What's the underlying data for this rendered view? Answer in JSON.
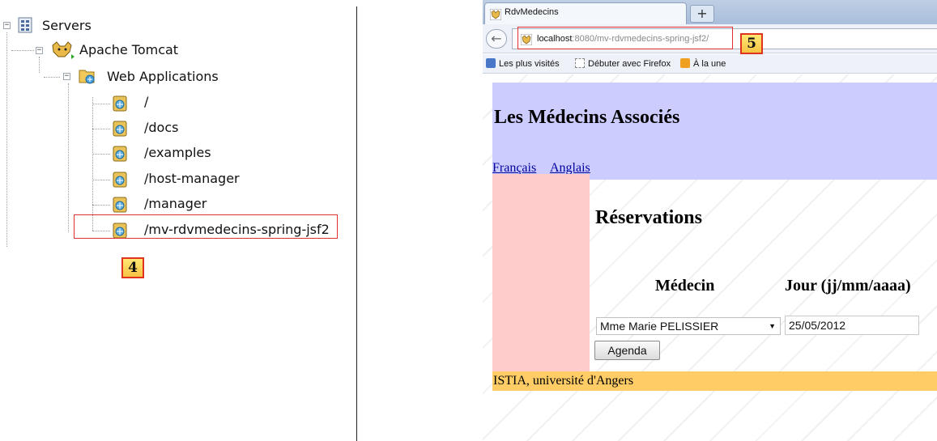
{
  "tree": {
    "servers": "Servers",
    "tomcat": "Apache Tomcat",
    "webapps": "Web Applications",
    "apps": [
      "/",
      "/docs",
      "/examples",
      "/host-manager",
      "/manager",
      "/mv-rdvmedecins-spring-jsf2"
    ],
    "marker": "4",
    "icons": {
      "servers": "servers-icon",
      "tomcat": "tomcat-icon",
      "webapps": "web-applications-icon",
      "app": "web-app-icon"
    }
  },
  "browser": {
    "tab_title": "RdvMedecins",
    "new_tab": "+",
    "url_host": "localhost",
    "url_rest": ":8080/mv-rdvmedecins-spring-jsf2/",
    "marker": "5",
    "bookmarks": [
      "Les plus visités",
      "Débuter avec Firefox",
      "À la une"
    ]
  },
  "page": {
    "title": "Les Médecins Associés",
    "lang_fr": "Français",
    "lang_en": "Anglais",
    "section_title": "Réservations",
    "col_medecin": "Médecin",
    "col_jour": "Jour (jj/mm/aaaa)",
    "medecin_value": "Mme Marie PELISSIER",
    "jour_value": "25/05/2012",
    "agenda_button": "Agenda",
    "footer": "ISTIA, université d'Angers"
  },
  "colors": {
    "header_bg": "#ccccff",
    "left_bg": "#ffcccc",
    "footer_bg": "#ffcc66",
    "highlight": "#e03030"
  }
}
